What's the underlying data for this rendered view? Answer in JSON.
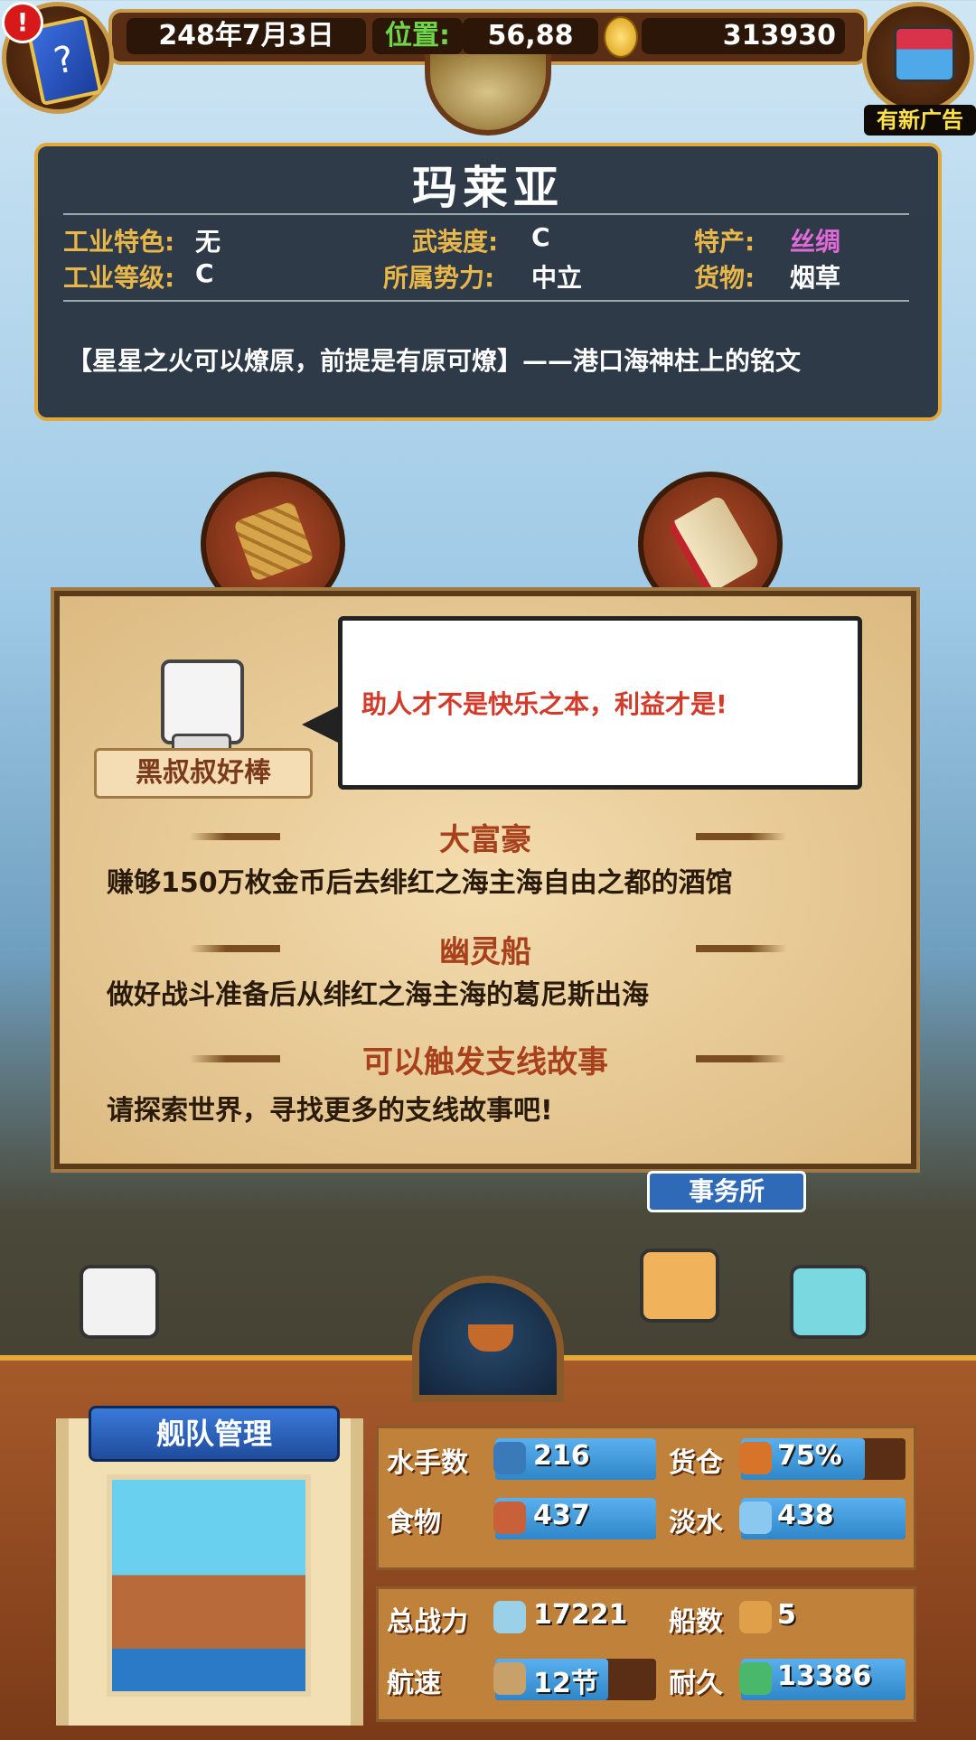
{
  "top": {
    "date": "248年7月3日",
    "position_label": "位置:",
    "position_value": "56,88",
    "gold": "313930",
    "alert": "!",
    "new_ad": "有新广告"
  },
  "port": {
    "name": "玛莱亚",
    "rows": [
      {
        "l1": "工业特色:",
        "v1": "无",
        "l2": "武装度:",
        "v2": "C",
        "l3": "特产:",
        "v3": "丝绸"
      },
      {
        "l1": "工业等级:",
        "v1": "C",
        "l2": "所属势力:",
        "v2": "中立",
        "l3": "货物:",
        "v3": "烟草"
      }
    ],
    "quote": "【星星之火可以燎原，前提是有原可燎】——港口海神柱上的铭文",
    "specialty_color": "#e06ad8"
  },
  "dialog": {
    "npc_name": "黑叔叔好棒",
    "speech": "助人才不是快乐之本，利益才是!",
    "stories": [
      {
        "title": "大富豪",
        "text": "赚够150万枚金币后去绯红之海主海自由之都的酒馆"
      },
      {
        "title": "幽灵船",
        "text": "做好战斗准备后从绯红之海主海的葛尼斯出海"
      },
      {
        "title": "可以触发支线故事",
        "text": "请探索世界，寻找更多的支线故事吧!"
      }
    ]
  },
  "behind_label": "事务所",
  "fleet": {
    "button": "舰队管理",
    "stats": [
      {
        "label": "水手数",
        "value": "216",
        "icon": "sailor-icon",
        "fill": 1.0
      },
      {
        "label": "货仓",
        "value": "75%",
        "icon": "cargo-icon",
        "fill": 0.75
      },
      {
        "label": "食物",
        "value": "437",
        "icon": "meat-icon",
        "fill": 1.0
      },
      {
        "label": "淡水",
        "value": "438",
        "icon": "water-icon",
        "fill": 1.0
      }
    ],
    "stats2": [
      {
        "label": "总战力",
        "value": "17221",
        "icon": "swords-icon"
      },
      {
        "label": "船数",
        "value": "5",
        "icon": "ship-count-icon"
      },
      {
        "label": "航速",
        "value": "12节",
        "icon": "speed-icon",
        "fill": 0.7
      },
      {
        "label": "耐久",
        "value": "13386",
        "icon": "durability-icon",
        "fill": 1.0
      }
    ]
  },
  "colors": {
    "panel_border": "#e0a93a",
    "accent_blue": "#2f86c8",
    "title_red": "#a8401c"
  }
}
